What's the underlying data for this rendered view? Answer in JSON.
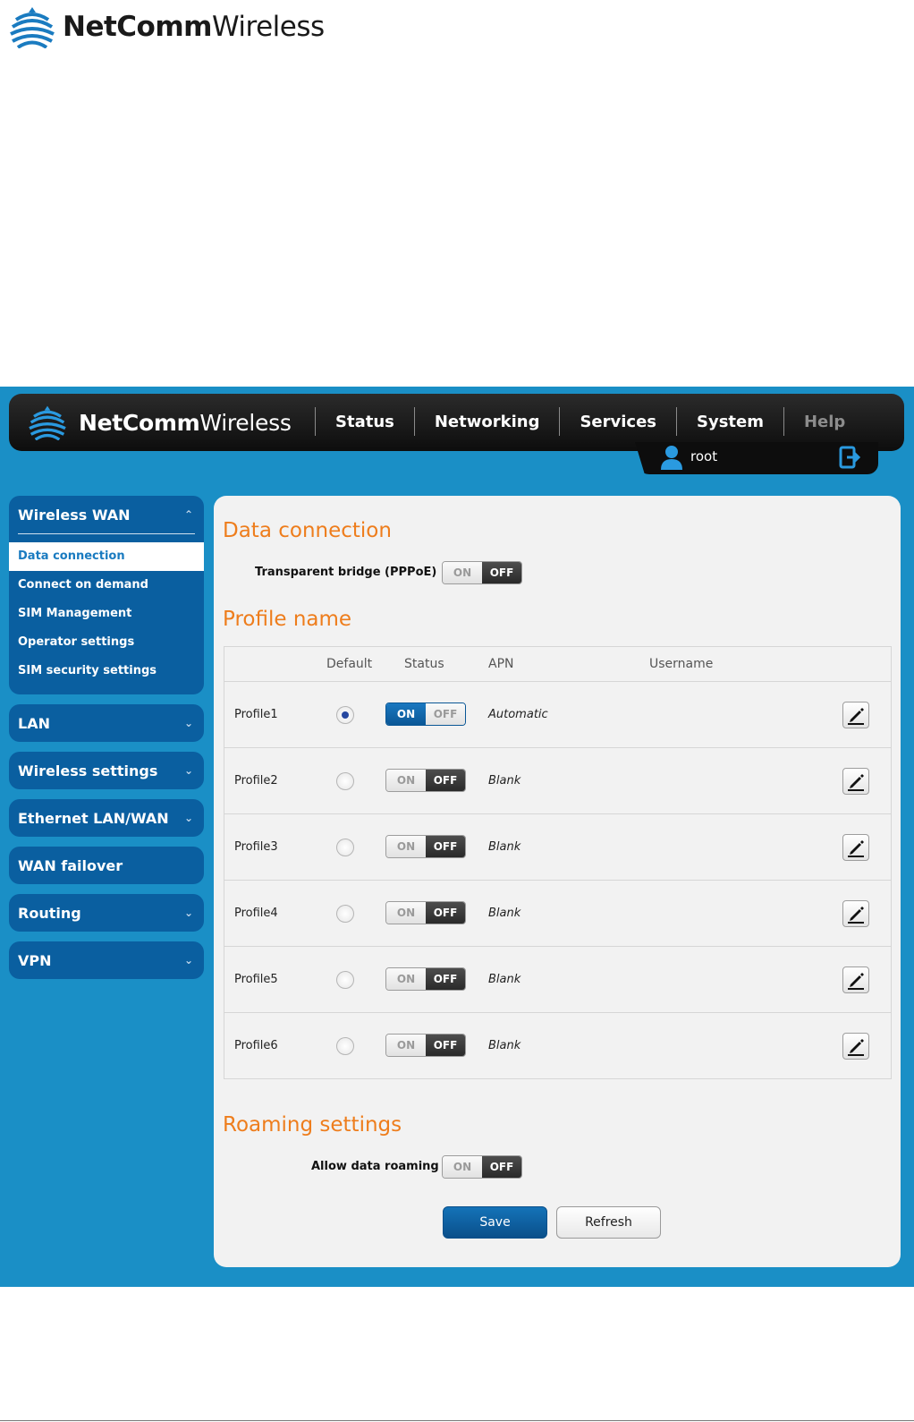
{
  "doc_logo": {
    "brand_bold": "NetComm",
    "brand_regular": "Wireless"
  },
  "topbar": {
    "brand_bold": "NetComm",
    "brand_regular": "Wireless",
    "nav": [
      "Status",
      "Networking",
      "Services",
      "System",
      "Help"
    ],
    "user": "root"
  },
  "sidebar": {
    "wireless_wan": {
      "label": "Wireless WAN",
      "items": [
        "Data connection",
        "Connect on demand",
        "SIM Management",
        "Operator settings",
        "SIM security settings"
      ]
    },
    "groups": [
      "LAN",
      "Wireless settings",
      "Ethernet LAN/WAN",
      "WAN failover",
      "Routing",
      "VPN"
    ]
  },
  "main": {
    "data_connection": {
      "title": "Data connection",
      "transparent_bridge_label": "Transparent bridge (PPPoE)",
      "transparent_bridge_state": "off"
    },
    "profile_name": {
      "title": "Profile name",
      "columns": {
        "default": "Default",
        "status": "Status",
        "apn": "APN",
        "username": "Username"
      },
      "profiles": [
        {
          "name": "Profile1",
          "default": true,
          "status": "on",
          "apn": "Automatic"
        },
        {
          "name": "Profile2",
          "default": false,
          "status": "off",
          "apn": "Blank"
        },
        {
          "name": "Profile3",
          "default": false,
          "status": "off",
          "apn": "Blank"
        },
        {
          "name": "Profile4",
          "default": false,
          "status": "off",
          "apn": "Blank"
        },
        {
          "name": "Profile5",
          "default": false,
          "status": "off",
          "apn": "Blank"
        },
        {
          "name": "Profile6",
          "default": false,
          "status": "off",
          "apn": "Blank"
        }
      ]
    },
    "roaming": {
      "title": "Roaming settings",
      "allow_label": "Allow data roaming",
      "allow_state": "off"
    },
    "buttons": {
      "save": "Save",
      "refresh": "Refresh"
    },
    "toggle_labels": {
      "on": "ON",
      "off": "OFF"
    }
  },
  "colors": {
    "frame_blue": "#1a8fc6",
    "sidebar_blue": "#0a5fa0",
    "heading_orange": "#ee7d1c",
    "toggle_on_blue": "#0a5796"
  }
}
